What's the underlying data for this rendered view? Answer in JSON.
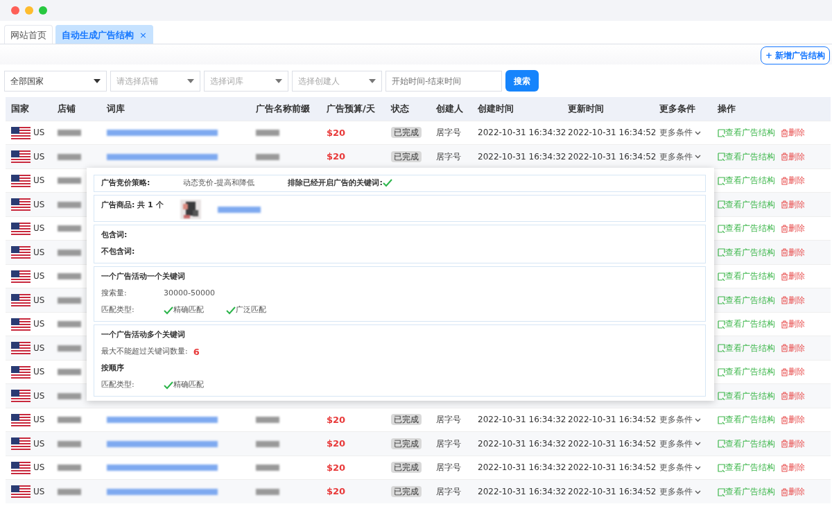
{
  "tabs": [
    {
      "label": "网站首页",
      "selected": false
    },
    {
      "label": "自动生成广告结构",
      "selected": true,
      "close": "×"
    }
  ],
  "toolbar": {
    "add_button": "新增广告结构",
    "add_icon": "+"
  },
  "filters": [
    {
      "kind": "select",
      "value": "全部国家"
    },
    {
      "kind": "select",
      "placeholder": "请选择店铺"
    },
    {
      "kind": "select",
      "placeholder": "选择词库"
    },
    {
      "kind": "select",
      "placeholder": "选择创建人"
    },
    {
      "kind": "input",
      "placeholder": "开始时间-结束时间"
    },
    {
      "kind": "button",
      "label": "搜索"
    }
  ],
  "table": {
    "columns": [
      "国家",
      "店铺",
      "词库",
      "广告名称前缀",
      "广告预算/天",
      "状态",
      "创建人",
      "创建时间",
      "更新时间",
      "更多条件",
      "操作"
    ],
    "rows": [
      {
        "country": "US",
        "budget": "$20",
        "status": "已完成",
        "creator": "居字号",
        "created": "2022-10-31 16:34:32",
        "updated": "2022-10-31 16:34:52",
        "more": "更多条件",
        "view": "查看广告结构",
        "delete": "删除"
      },
      {
        "country": "US",
        "budget": "$20",
        "status": "已完成",
        "creator": "居字号",
        "created": "2022-10-31 16:34:32",
        "updated": "2022-10-31 16:34:52",
        "more": "更多条件",
        "view": "查看广告结构",
        "delete": "删除"
      },
      {
        "country": "US",
        "view": "查看广告结构",
        "delete": "删除"
      },
      {
        "country": "US",
        "view": "查看广告结构",
        "delete": "删除"
      },
      {
        "country": "US",
        "view": "查看广告结构",
        "delete": "删除"
      },
      {
        "country": "US",
        "view": "查看广告结构",
        "delete": "删除"
      },
      {
        "country": "US",
        "view": "查看广告结构",
        "delete": "删除"
      },
      {
        "country": "US",
        "view": "查看广告结构",
        "delete": "删除"
      },
      {
        "country": "US",
        "view": "查看广告结构",
        "delete": "删除"
      },
      {
        "country": "US",
        "view": "查看广告结构",
        "delete": "删除"
      },
      {
        "country": "US",
        "view": "查看广告结构",
        "delete": "删除"
      },
      {
        "country": "US",
        "view": "查看广告结构",
        "delete": "删除"
      },
      {
        "country": "US",
        "budget": "$20",
        "status": "已完成",
        "creator": "居字号",
        "created": "2022-10-31 16:34:32",
        "updated": "2022-10-31 16:34:52",
        "more": "更多条件",
        "view": "查看广告结构",
        "delete": "删除"
      },
      {
        "country": "US",
        "budget": "$20",
        "status": "已完成",
        "creator": "居字号",
        "created": "2022-10-31 16:34:32",
        "updated": "2022-10-31 16:34:52",
        "more": "更多条件",
        "view": "查看广告结构",
        "delete": "删除"
      },
      {
        "country": "US",
        "budget": "$20",
        "status": "已完成",
        "creator": "居字号",
        "created": "2022-10-31 16:34:32",
        "updated": "2022-10-31 16:34:52",
        "more": "更多条件",
        "view": "查看广告结构",
        "delete": "删除"
      },
      {
        "country": "US",
        "budget": "$20",
        "status": "已完成",
        "creator": "居字号",
        "created": "2022-10-31 16:34:32",
        "updated": "2022-10-31 16:34:52",
        "more": "更多条件",
        "view": "查看广告结构",
        "delete": "删除"
      }
    ]
  },
  "popover": {
    "strategy": {
      "label": "广告竞价策略:",
      "value": "动态竞价-提高和降低",
      "exclude_label": "排除已经开启广告的关键词:",
      "exclude_checked": true
    },
    "products": {
      "label": "广告商品: 共 1 个"
    },
    "words": {
      "include": "包含词:",
      "exclude": "不包含词:"
    },
    "single": {
      "title": "一个广告活动一个关键词",
      "volume_label": "搜索量:",
      "volume": "30000-50000",
      "match_label": "匹配类型:",
      "match": [
        {
          "label": "精确匹配",
          "checked": true
        },
        {
          "label": "广泛匹配",
          "checked": true
        }
      ]
    },
    "multi": {
      "title": "一个广告活动多个关键词",
      "max_label": "最大不能超过关键词数量:",
      "max": "6",
      "order": "按顺序",
      "match_label": "匹配类型:",
      "match": [
        {
          "label": "精确匹配",
          "checked": true
        }
      ]
    }
  }
}
